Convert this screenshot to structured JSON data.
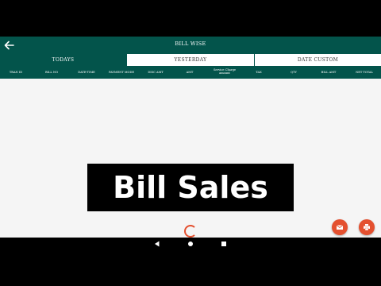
{
  "appbar": {
    "title": "BILL WISE",
    "back_icon": "arrow-back-icon"
  },
  "tabs": [
    {
      "label": "TODAYS",
      "active": true
    },
    {
      "label": "YESTERDAY",
      "active": false
    },
    {
      "label": "DATE CUSTOM",
      "active": false
    }
  ],
  "columns": [
    "TRAN ID",
    "BILL NO",
    "DATE-TIME",
    "PAYMENT MODE",
    "DISC AMT",
    "AMT",
    "Service Charge amount",
    "TAX",
    "QTY",
    "BILL AMT",
    "NET TOTAL"
  ],
  "banner": {
    "text": "Bill Sales"
  },
  "fabs": {
    "mail_icon": "mail-icon",
    "print_icon": "printer-icon"
  },
  "colors": {
    "primary": "#03544b",
    "accent": "#e4502f",
    "content_bg": "#f5f5f5"
  }
}
